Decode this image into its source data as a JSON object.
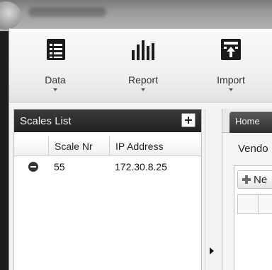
{
  "ribbon": {
    "items": [
      {
        "label": "Data",
        "icon": "data-table-icon"
      },
      {
        "label": "Report",
        "icon": "bar-chart-icon"
      },
      {
        "label": "Import",
        "icon": "import-icon"
      }
    ]
  },
  "scales_list": {
    "title": "Scales List",
    "columns": [
      "Scale Nr",
      "IP Address"
    ],
    "rows": [
      {
        "scale_nr": "55",
        "ip_address": "172.30.8.25"
      }
    ]
  },
  "right_panel": {
    "tabs": [
      "Home"
    ],
    "vendor_label": "Vendo",
    "new_button_label": "Ne"
  },
  "colors": {
    "panel_header": "#2a2a2a",
    "ribbon_bg": "#eeeeee",
    "window_bg": "#f3f3f3"
  }
}
